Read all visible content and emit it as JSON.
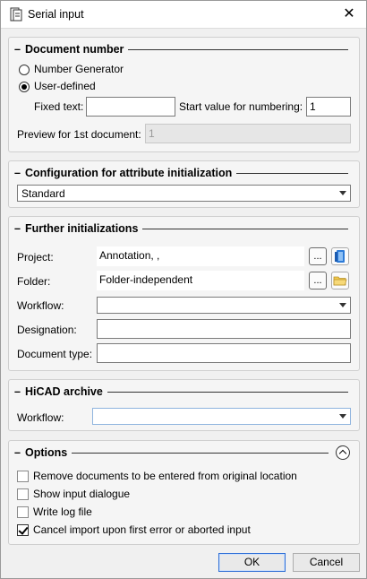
{
  "window": {
    "title": "Serial input",
    "close_label": "✕"
  },
  "document_number": {
    "title": "Document number",
    "radio_number_generator": "Number Generator",
    "radio_user_defined": "User-defined",
    "selected": "User-defined",
    "fixed_text_label": "Fixed text:",
    "fixed_text_value": "",
    "start_value_label": "Start value for numbering:",
    "start_value": "1",
    "preview_label": "Preview for 1st document:",
    "preview_value": "1"
  },
  "config": {
    "title": "Configuration for attribute initialization",
    "selected": "Standard"
  },
  "further": {
    "title": "Further initializations",
    "project_label": "Project:",
    "project_value": "Annotation, ,",
    "folder_label": "Folder:",
    "folder_value": "Folder-independent",
    "workflow_label": "Workflow:",
    "workflow_value": "",
    "designation_label": "Designation:",
    "designation_value": "",
    "doctype_label": "Document type:",
    "doctype_value": "",
    "ellipsis": "..."
  },
  "hicad": {
    "title": "HiCAD archive",
    "workflow_label": "Workflow:",
    "workflow_value": ""
  },
  "options": {
    "title": "Options",
    "items": [
      {
        "label": "Remove documents to be entered from original location",
        "checked": false
      },
      {
        "label": "Show input dialogue",
        "checked": false
      },
      {
        "label": "Write log file",
        "checked": false
      },
      {
        "label": "Cancel import upon first error or aborted input",
        "checked": true
      }
    ]
  },
  "footer": {
    "ok_label": "OK",
    "cancel_label": "Cancel"
  },
  "colors": {
    "default_button_border": "#2f6fd6",
    "folder_icon": "#f2c94c",
    "book_icon": "#2d7bd8"
  }
}
